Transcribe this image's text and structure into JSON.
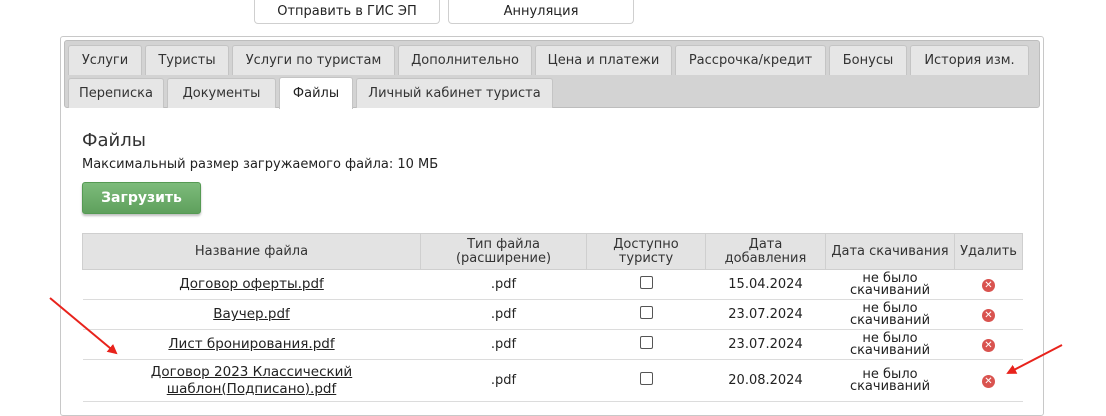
{
  "top_buttons": {
    "send_gis": "Отправить в ГИС ЭП",
    "annulment": "Аннуляция"
  },
  "tabs": {
    "row1": [
      "Услуги",
      "Туристы",
      "Услуги по туристам",
      "Дополнительно",
      "Цена и платежи",
      "Рассрочка/кредит",
      "Бонусы",
      "История изм."
    ],
    "row2": [
      "Переписка",
      "Документы",
      "Файлы",
      "Личный кабинет туриста"
    ],
    "active": "Файлы"
  },
  "section": {
    "title": "Файлы",
    "max_size": "Максимальный размер загружаемого файла: 10 МБ",
    "upload_label": "Загрузить"
  },
  "table": {
    "headers": {
      "name": "Название файла",
      "type": "Тип файла (расширение)",
      "available": "Доступно туристу",
      "date_added": "Дата добавления",
      "date_downloaded": "Дата скачивания",
      "delete": "Удалить"
    },
    "rows": [
      {
        "name": "Договор оферты.pdf",
        "type": ".pdf",
        "available": false,
        "date_added": "15.04.2024",
        "downloaded": "не было скачиваний"
      },
      {
        "name": "Ваучер.pdf",
        "type": ".pdf",
        "available": false,
        "date_added": "23.07.2024",
        "downloaded": "не было скачиваний"
      },
      {
        "name": "Лист бронирования.pdf",
        "type": ".pdf",
        "available": false,
        "date_added": "23.07.2024",
        "downloaded": "не было скачиваний"
      },
      {
        "name": "Договор 2023 Классический шаблон(Подписано).pdf",
        "type": ".pdf",
        "available": false,
        "date_added": "20.08.2024",
        "downloaded": "не было скачиваний"
      }
    ]
  },
  "colors": {
    "upload_green": "#6aab68",
    "delete_red": "#d9534f",
    "annotation_arrow": "#e8231c"
  }
}
